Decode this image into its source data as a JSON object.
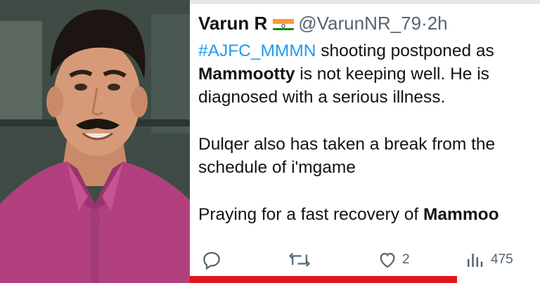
{
  "tweet": {
    "author_name": "Varun R",
    "handle": "@VarunNR_79",
    "separator": "·",
    "time": "2h",
    "line1_hashtag": "#AJFC_MMMN",
    "line1_rest": " shooting postponed as",
    "line2_bold": "Mammootty",
    "line2_rest": " is not keeping well. He is",
    "line3": "diagnosed with a serious illness.",
    "line4": "Dulqer also has taken a break from the",
    "line5": "schedule of i'mgame",
    "line6_rest": "Praying for a fast recovery of ",
    "line6_bold": "Mammoo",
    "actions": {
      "reply_icon": "reply-icon",
      "retweet_icon": "retweet-icon",
      "like_icon": "heart-icon",
      "like_count": "2",
      "views_icon": "views-icon",
      "views_count": "475"
    }
  },
  "colors": {
    "link": "#1d9bf0",
    "text": "#0f1419",
    "muted": "#536471",
    "accent_bar": "#e0161c",
    "shirt": "#b2407f"
  }
}
